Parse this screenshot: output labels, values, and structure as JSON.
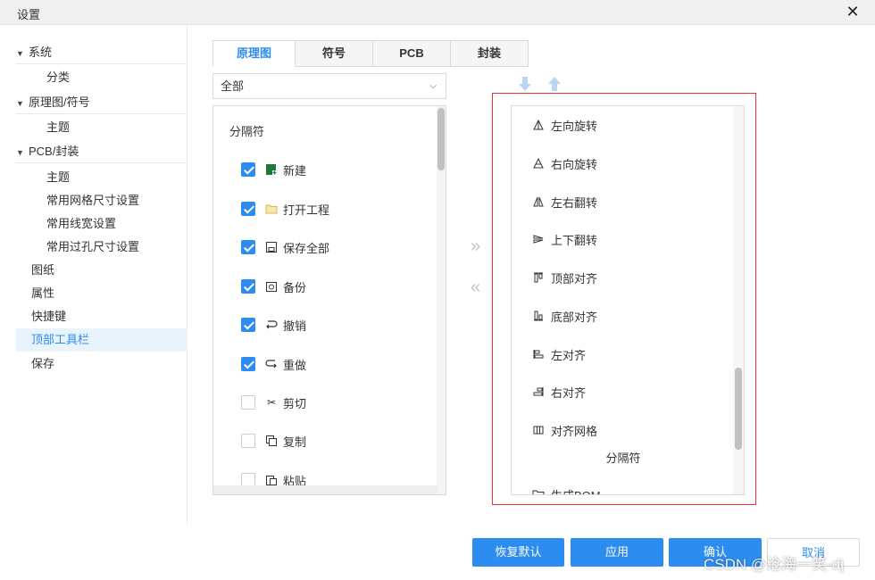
{
  "window": {
    "title": "设置",
    "close_glyph": "✕"
  },
  "sidebar": {
    "system": "系统",
    "category": "分类",
    "schematic_symbol": "原理图/符号",
    "theme1": "主题",
    "pcb_footprint": "PCB/封装",
    "theme2": "主题",
    "grid_size": "常用网格尺寸设置",
    "line_width": "常用线宽设置",
    "via_size": "常用过孔尺寸设置",
    "drawing": "图纸",
    "attributes": "属性",
    "shortcuts": "快捷键",
    "top_toolbar": "顶部工具栏",
    "save": "保存"
  },
  "tabs": [
    "原理图",
    "符号",
    "PCB",
    "封装"
  ],
  "select": {
    "value": "全部"
  },
  "left_list": {
    "separator": "分隔符",
    "items": [
      {
        "label": "新建",
        "checked": true,
        "icon": "new-file-icon"
      },
      {
        "label": "打开工程",
        "checked": true,
        "icon": "folder-icon"
      },
      {
        "label": "保存全部",
        "checked": true,
        "icon": "save-all-icon"
      },
      {
        "label": "备份",
        "checked": true,
        "icon": "backup-icon"
      },
      {
        "label": "撤销",
        "checked": true,
        "icon": "undo-icon"
      },
      {
        "label": "重做",
        "checked": true,
        "icon": "redo-icon"
      },
      {
        "label": "剪切",
        "checked": false,
        "icon": "cut-icon"
      },
      {
        "label": "复制",
        "checked": false,
        "icon": "copy-icon"
      },
      {
        "label": "粘贴",
        "checked": false,
        "icon": "paste-icon"
      }
    ]
  },
  "right_list": {
    "items": [
      {
        "label": "左向旋转",
        "icon": "rotate-left-icon"
      },
      {
        "label": "右向旋转",
        "icon": "rotate-right-icon"
      },
      {
        "label": "左右翻转",
        "icon": "flip-horizontal-icon"
      },
      {
        "label": "上下翻转",
        "icon": "flip-vertical-icon"
      },
      {
        "label": "顶部对齐",
        "icon": "align-top-icon"
      },
      {
        "label": "底部对齐",
        "icon": "align-bottom-icon"
      },
      {
        "label": "左对齐",
        "icon": "align-left-icon"
      },
      {
        "label": "右对齐",
        "icon": "align-right-icon"
      },
      {
        "label": "对齐网格",
        "icon": "align-grid-icon"
      }
    ],
    "separator": "分隔符",
    "partial_item": "生成BOM"
  },
  "buttons": {
    "restore_default": "恢复默认",
    "apply": "应用",
    "confirm": "确认",
    "cancel": "取消"
  },
  "watermark": "CSDN @沧海一笑-dj",
  "colors": {
    "accent": "#2d8cf0",
    "highlight_frame": "#e33333"
  }
}
